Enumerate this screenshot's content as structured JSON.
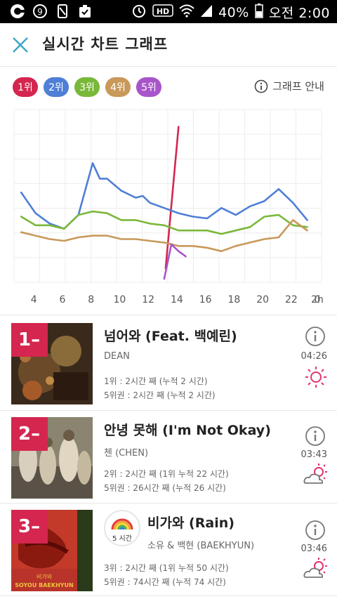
{
  "statusbar": {
    "battery": "40%",
    "time": "오전 2:00",
    "hd": "HD"
  },
  "header": {
    "title": "실시간 차트 그래프"
  },
  "chips": [
    {
      "label": "1위",
      "color": "#d4264f"
    },
    {
      "label": "2위",
      "color": "#4f7fd6"
    },
    {
      "label": "3위",
      "color": "#7ab83a"
    },
    {
      "label": "4위",
      "color": "#c8995a"
    },
    {
      "label": "5위",
      "color": "#a755c9"
    }
  ],
  "guide_label": "그래프 안내",
  "chart_data": {
    "type": "line",
    "x_tick_labels": [
      "4",
      "6",
      "8",
      "10",
      "12",
      "14",
      "16",
      "18",
      "20",
      "22",
      "0",
      "2h"
    ],
    "series": [
      {
        "name": "1위",
        "color": "#d4264f",
        "points": [
          [
            0.1,
            8
          ],
          [
            1.0,
            90
          ]
        ]
      },
      {
        "name": "2위",
        "color": "#4f7fd6",
        "points": [
          [
            -10.0,
            52
          ],
          [
            -9.0,
            40
          ],
          [
            -8.0,
            34
          ],
          [
            -7.0,
            31
          ],
          [
            -6.0,
            39
          ],
          [
            -5.0,
            69
          ],
          [
            -4.5,
            60
          ],
          [
            -4.0,
            60
          ],
          [
            -3.0,
            53
          ],
          [
            -2.0,
            49
          ],
          [
            -1.5,
            50
          ],
          [
            -1.0,
            46
          ],
          [
            0.0,
            43
          ],
          [
            1.0,
            40
          ],
          [
            2.0,
            38
          ],
          [
            3.0,
            37
          ],
          [
            4.0,
            43
          ],
          [
            5.0,
            39
          ],
          [
            6.0,
            44
          ],
          [
            7.0,
            47
          ],
          [
            8.0,
            54
          ],
          [
            9.0,
            46
          ],
          [
            10.0,
            36
          ]
        ]
      },
      {
        "name": "3위",
        "color": "#7ab83a",
        "points": [
          [
            -10.0,
            38
          ],
          [
            -9.0,
            33
          ],
          [
            -8.0,
            33
          ],
          [
            -7.0,
            31
          ],
          [
            -6.0,
            39
          ],
          [
            -5.0,
            41
          ],
          [
            -4.0,
            40
          ],
          [
            -3.0,
            36
          ],
          [
            -2.0,
            36
          ],
          [
            -1.0,
            34
          ],
          [
            0.0,
            33
          ],
          [
            1.0,
            30
          ],
          [
            2.0,
            30
          ],
          [
            3.0,
            30
          ],
          [
            4.0,
            28
          ],
          [
            5.0,
            30
          ],
          [
            6.0,
            32
          ],
          [
            7.0,
            38
          ],
          [
            8.0,
            39
          ],
          [
            9.0,
            33
          ],
          [
            10.0,
            32
          ]
        ]
      },
      {
        "name": "4위",
        "color": "#c8995a",
        "points": [
          [
            -10.0,
            29
          ],
          [
            -9.0,
            27
          ],
          [
            -8.0,
            25
          ],
          [
            -7.0,
            24
          ],
          [
            -6.0,
            26
          ],
          [
            -5.0,
            27
          ],
          [
            -4.0,
            27
          ],
          [
            -3.0,
            25
          ],
          [
            -2.0,
            25
          ],
          [
            -1.0,
            24
          ],
          [
            0.0,
            23
          ],
          [
            1.0,
            21
          ],
          [
            2.0,
            21
          ],
          [
            3.0,
            20
          ],
          [
            4.0,
            18
          ],
          [
            5.0,
            21
          ],
          [
            6.0,
            23
          ],
          [
            7.0,
            25
          ],
          [
            8.0,
            26
          ],
          [
            9.0,
            36
          ],
          [
            10.0,
            30
          ]
        ]
      },
      {
        "name": "5위",
        "color": "#a755c9",
        "points": [
          [
            0.0,
            2
          ],
          [
            0.5,
            22
          ],
          [
            1.0,
            18
          ],
          [
            1.5,
            15
          ]
        ]
      }
    ]
  },
  "songs": [
    {
      "rank": "1",
      "title": "넘어와 (Feat. 백예린)",
      "artist": "DEAN",
      "stat1": "1위 : 2시간 째 (누적 2 시간)",
      "stat2": "5위권 : 2시간 째 (누적 2 시간)",
      "time": "04:26",
      "weather_icon": "sun-icon"
    },
    {
      "rank": "2",
      "title": "안녕 못해 (I'm Not Okay)",
      "artist": "첸 (CHEN)",
      "stat1": "2위 : 2시간 째 (1위 누적 22 시간)",
      "stat2": "5위권 : 26시간 째 (누적 26 시간)",
      "time": "03:43",
      "weather_icon": "partly-cloudy-icon"
    },
    {
      "rank": "3",
      "title": "비가와 (Rain)",
      "artist": "소유 & 백현 (BAEKHYUN)",
      "stat1": "3위 : 2시간 째 (1위 누적 50 시간)",
      "stat2": "5위권 : 74시간 째 (누적 74 시간)",
      "time": "03:46",
      "weather_icon": "partly-cloudy-icon",
      "hours_badge": "5 시간",
      "cover_text": "SOYOU BAEKHYUN"
    }
  ]
}
